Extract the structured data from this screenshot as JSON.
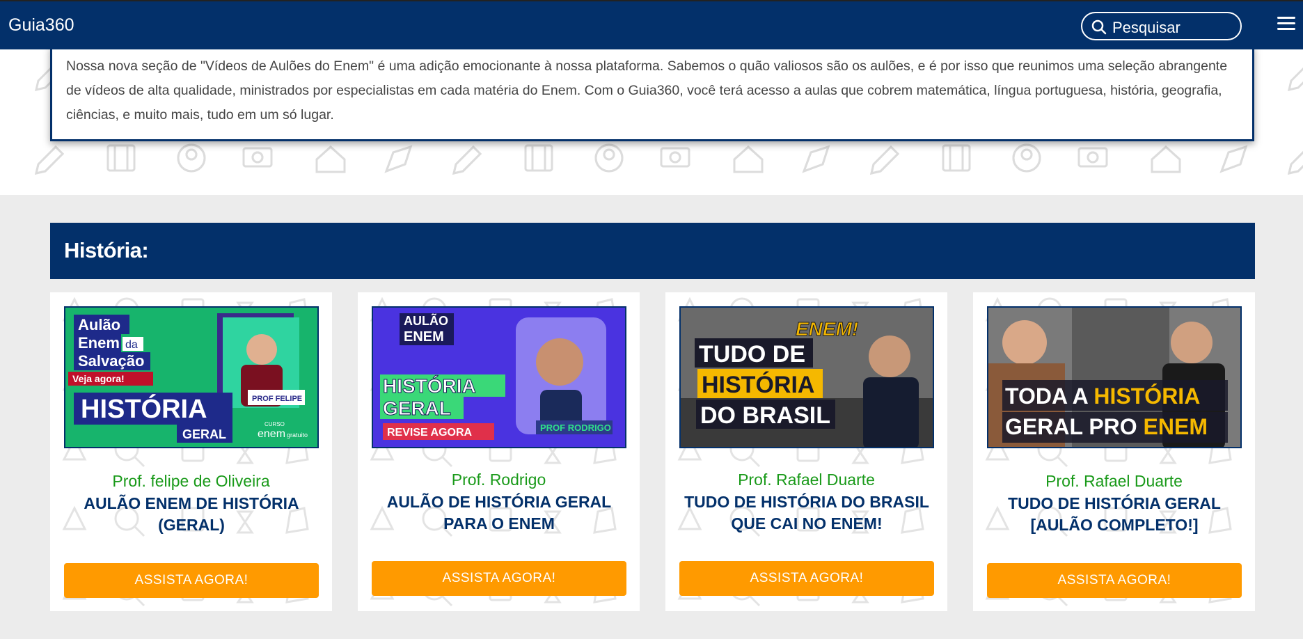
{
  "nav": {
    "brand": "Guia360",
    "search_placeholder": "Pesquisar"
  },
  "intro": {
    "text": "Nossa nova seção de \"Vídeos de Aulões do Enem\" é uma adição emocionante à nossa plataforma. Sabemos o quão valiosos são os aulões, e é por isso que reunimos uma seleção abrangente de vídeos de alta qualidade, ministrados por especialistas em cada matéria do Enem. Com o Guia360, você terá acesso a aulas que cobrem matemática, língua portuguesa, história, geografia, ciências, e muito mais, tudo em um só lugar."
  },
  "section": {
    "title": "História:"
  },
  "cards": [
    {
      "professor": "Prof. felipe de Oliveira",
      "title": "AULÃO ENEM DE HISTÓRIA (GERAL)",
      "button": "ASSISTA AGORA!",
      "thumb": {
        "line1": "Aulão",
        "line2": "Enem",
        "line2b": "da",
        "line3": "Salvação",
        "cta": "Veja agora!",
        "big": "HISTÓRIA",
        "sub": "GERAL",
        "tag": "PROF FELIPE",
        "brand": "enem",
        "brand_small": "CURSO",
        "brand_suffix": "gratuito"
      }
    },
    {
      "professor": "Prof. Rodrigo",
      "title": "AULÃO DE HISTÓRIA GERAL PARA O ENEM",
      "button": "ASSISTA AGORA!",
      "thumb": {
        "badge1": "AULÃO",
        "badge2": "ENEM",
        "big1": "HISTÓRIA",
        "big2": "GERAL",
        "cta": "REVISE AGORA",
        "tag": "PROF RODRIGO"
      }
    },
    {
      "professor": "Prof. Rafael Duarte",
      "title": "TUDO DE HISTÓRIA DO BRASIL QUE CAI NO ENEM!",
      "button": "ASSISTA AGORA!",
      "thumb": {
        "stamp": "ENEM!",
        "l1": "TUDO DE",
        "l2": "HISTÓRIA",
        "l3": "DO BRASIL"
      }
    },
    {
      "professor": "Prof. Rafael Duarte",
      "title": "TUDO DE HISTÓRIA GERAL [AULÃO COMPLETO!]",
      "button": "ASSISTA AGORA!",
      "thumb": {
        "l1a": "TODA A ",
        "l1b": "HISTÓRIA",
        "l2a": "GERAL PRO ",
        "l2b": "ENEM"
      }
    }
  ],
  "colors": {
    "navy": "#03306a",
    "orange": "#ff9a00",
    "green": "#1a9a1a"
  }
}
